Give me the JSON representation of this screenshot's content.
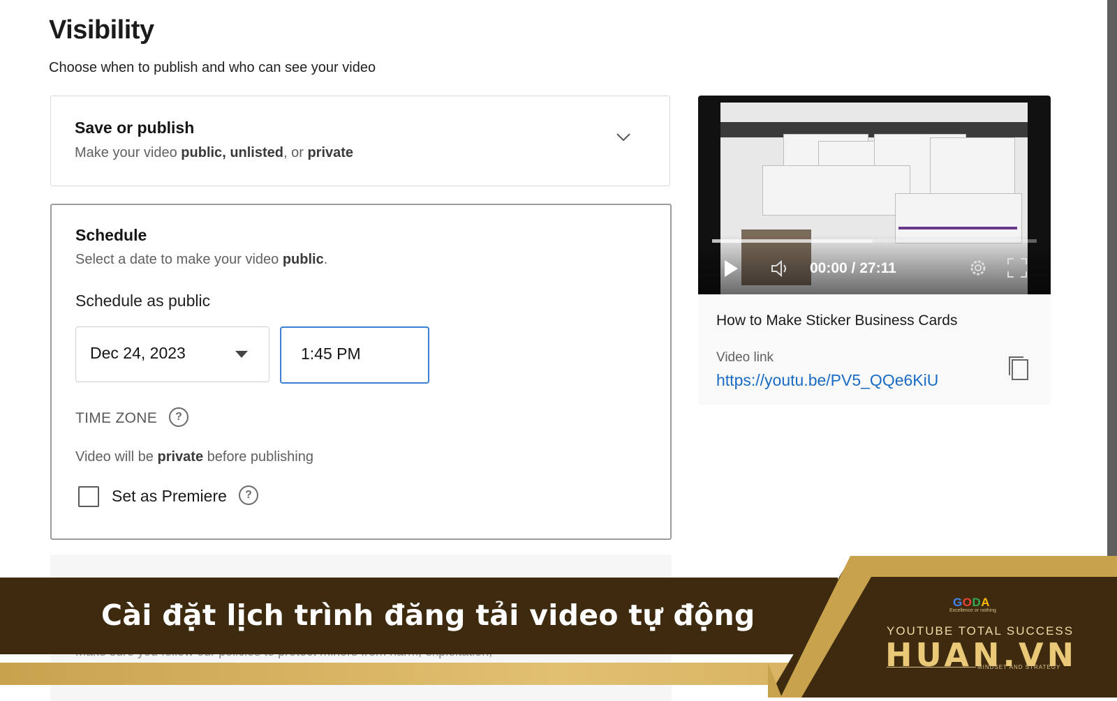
{
  "page": {
    "title": "Visibility",
    "subtitle": "Choose when to publish and who can see your video"
  },
  "save_publish": {
    "title": "Save or publish",
    "desc_prefix": "Make your video ",
    "desc_public": "public",
    "desc_sep1": ", ",
    "desc_unlisted": "unlisted",
    "desc_sep2": ", or ",
    "desc_private": "private",
    "expand_icon": "chevron-down-icon"
  },
  "schedule": {
    "title": "Schedule",
    "desc_prefix": "Select a date to make your video ",
    "desc_public": "public",
    "desc_suffix": ".",
    "schedule_label": "Schedule as public",
    "date_value": "Dec 24, 2023",
    "time_value": "1:45 PM",
    "time_zone_label": "TIME ZONE",
    "help_symbol": "?",
    "note_prefix": "Video will be ",
    "note_private": "private",
    "note_suffix": " before publishing",
    "premiere_label": "Set as Premiere",
    "premiere_checked": false
  },
  "ghost": {
    "text": "Make sure you follow our policies to protect minors from harm, exploitation,"
  },
  "video": {
    "time": "00:00 / 27:11",
    "title": "How to Make Sticker Business Cards",
    "link_label": "Video link",
    "link": "https://youtu.be/PV5_QQe6KiU",
    "icons": [
      "play-icon",
      "volume-icon",
      "settings-gear-icon",
      "fullscreen-icon",
      "copy-icon"
    ]
  },
  "banner": {
    "text": "Cài đặt lịch trình đăng tải video tự động",
    "colors": {
      "dark": "#3e2a0f",
      "gold": "#d9b566"
    }
  },
  "brand": {
    "goda_g": "G",
    "goda_o": "O",
    "goda_d": "D",
    "goda_a": "A",
    "goda_tagline": "Excellence or nothing",
    "line1": "YOUTUBE TOTAL SUCCESS",
    "name": "HUAN.VN",
    "tagline": "MINDSET AND STRATEGY"
  }
}
